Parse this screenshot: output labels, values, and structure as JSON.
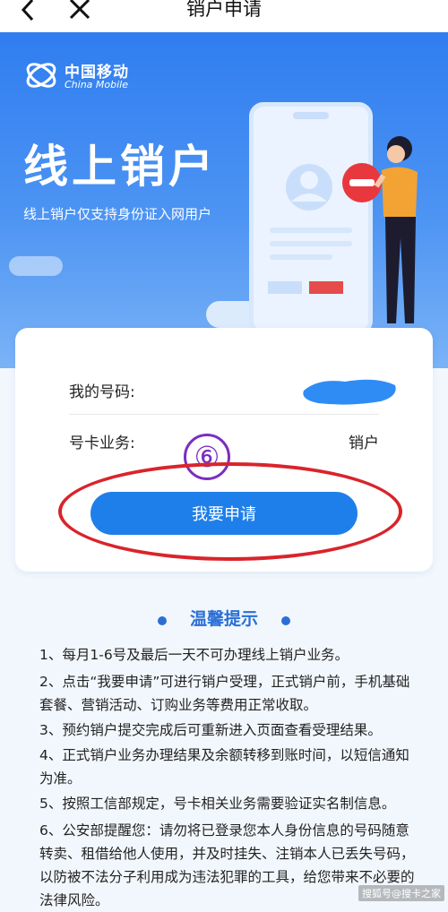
{
  "topbar": {
    "title": "销户申请"
  },
  "banner": {
    "brand_cn": "中国移动",
    "brand_en": "China Mobile",
    "title": "线上销户",
    "subtitle": "线上销户仅支持身份证入网用户"
  },
  "card": {
    "number_label": "我的号码:",
    "service_label": "号卡业务:",
    "service_value": "销户",
    "annotation": "⑥",
    "apply_button": "我要申请"
  },
  "tips": {
    "title": "温馨提示",
    "items": [
      "1、每月1-6号及最后一天不可办理线上销户业务。",
      "2、点击“我要申请”可进行销户受理，正式销户前，手机基础套餐、营销活动、订购业务等费用正常收取。",
      "3、预约销户提交完成后可重新进入页面查看受理结果。",
      "4、正式销户业务办理结果及余额转移到账时间，以短信通知为准。",
      "5、按照工信部规定，号卡相关业务需要验证实名制信息。",
      "6、公安部提醒您：请勿将已登录您本人身份信息的号码随意转卖、租借给他人使用，并及时挂失、注销本人已丢失号码，以防被不法分子利用成为违法犯罪的工具，给您带来不必要的法律风险。"
    ]
  },
  "watermark": "搜狐号@搜卡之家",
  "colors": {
    "accent": "#1f7fea",
    "annotation_red": "#d9242b",
    "annotation_purple": "#7b2fbf"
  }
}
